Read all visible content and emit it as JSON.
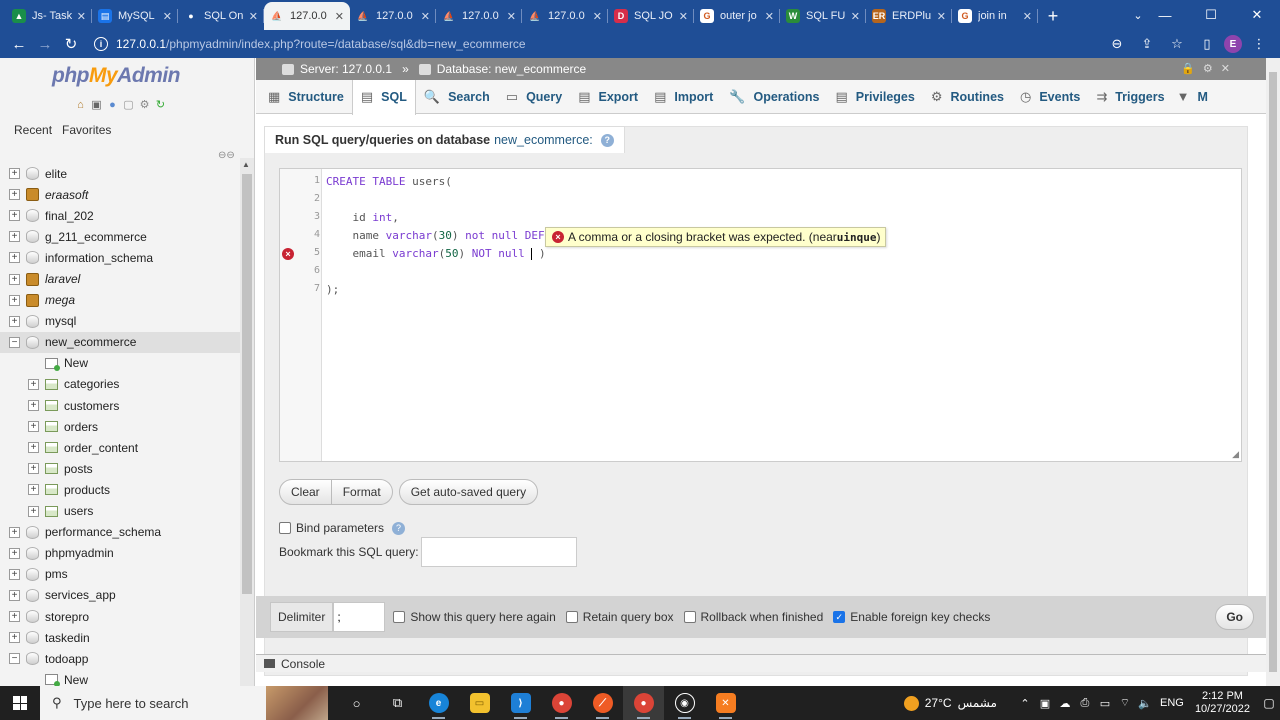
{
  "browser": {
    "tabs": [
      {
        "title": "Js- Task",
        "fav_color": "#1a8e4a",
        "fav_glyph": "▲"
      },
      {
        "title": "MySQL",
        "fav_color": "#1a73e8",
        "fav_glyph": "▤"
      },
      {
        "title": "SQL On",
        "fav_color": "#1f4e96",
        "fav_glyph": "●"
      },
      {
        "title": "127.0.0",
        "fav_color": "#f1f3f4",
        "fav_glyph": "⛵",
        "active": true
      },
      {
        "title": "127.0.0",
        "fav_color": "#1f4e96",
        "fav_glyph": "⛵"
      },
      {
        "title": "127.0.0",
        "fav_color": "#1f4e96",
        "fav_glyph": "⛵"
      },
      {
        "title": "127.0.0",
        "fav_color": "#1f4e96",
        "fav_glyph": "⛵"
      },
      {
        "title": "SQL JO",
        "fav_color": "#d62d4a",
        "fav_glyph": "D"
      },
      {
        "title": "outer jo",
        "fav_color": "#ffffff",
        "fav_glyph": "G"
      },
      {
        "title": "SQL FU",
        "fav_color": "#2a8c3a",
        "fav_glyph": "W"
      },
      {
        "title": "ERDPlu",
        "fav_color": "#b5651d",
        "fav_glyph": "ER"
      },
      {
        "title": "join in",
        "fav_color": "#ffffff",
        "fav_glyph": "G"
      }
    ],
    "url_host": "127.0.0.1",
    "url_path": "/phpmyadmin/index.php?route=/database/sql&db=new_ecommerce",
    "profile_initial": "E"
  },
  "nav": {
    "logo_php": "php",
    "logo_my": "My",
    "logo_admin": "Admin",
    "recent": "Recent",
    "favorites": "Favorites",
    "tree": [
      {
        "name": "elite",
        "type": "db",
        "level": 0
      },
      {
        "name": "eraasoft",
        "type": "group",
        "level": 0
      },
      {
        "name": "final_202",
        "type": "db",
        "level": 0
      },
      {
        "name": "g_211_ecommerce",
        "type": "db",
        "level": 0
      },
      {
        "name": "information_schema",
        "type": "db",
        "level": 0
      },
      {
        "name": "laravel",
        "type": "group",
        "level": 0
      },
      {
        "name": "mega",
        "type": "group",
        "level": 0
      },
      {
        "name": "mysql",
        "type": "db",
        "level": 0
      },
      {
        "name": "new_ecommerce",
        "type": "db",
        "level": 0,
        "expanded": true,
        "selected": true
      },
      {
        "name": "New",
        "type": "new",
        "level": 1
      },
      {
        "name": "categories",
        "type": "table",
        "level": 1
      },
      {
        "name": "customers",
        "type": "table",
        "level": 1
      },
      {
        "name": "orders",
        "type": "table",
        "level": 1
      },
      {
        "name": "order_content",
        "type": "table",
        "level": 1
      },
      {
        "name": "posts",
        "type": "table",
        "level": 1
      },
      {
        "name": "products",
        "type": "table",
        "level": 1
      },
      {
        "name": "users",
        "type": "table",
        "level": 1
      },
      {
        "name": "performance_schema",
        "type": "db",
        "level": 0
      },
      {
        "name": "phpmyadmin",
        "type": "db",
        "level": 0
      },
      {
        "name": "pms",
        "type": "db",
        "level": 0
      },
      {
        "name": "services_app",
        "type": "db",
        "level": 0
      },
      {
        "name": "storepro",
        "type": "db",
        "level": 0
      },
      {
        "name": "taskedin",
        "type": "db",
        "level": 0
      },
      {
        "name": "todoapp",
        "type": "db",
        "level": 0,
        "expanded": true
      },
      {
        "name": "New",
        "type": "new",
        "level": 1
      }
    ]
  },
  "main": {
    "server": "Server: 127.0.0.1",
    "database": "Database: new_ecommerce",
    "tabs": [
      {
        "label": "Structure",
        "icon": "▦"
      },
      {
        "label": "SQL",
        "icon": "▤",
        "active": true
      },
      {
        "label": "Search",
        "icon": "🔍"
      },
      {
        "label": "Query",
        "icon": "▭"
      },
      {
        "label": "Export",
        "icon": "▤"
      },
      {
        "label": "Import",
        "icon": "▤"
      },
      {
        "label": "Operations",
        "icon": "🔧"
      },
      {
        "label": "Privileges",
        "icon": "▤"
      },
      {
        "label": "Routines",
        "icon": "⚙"
      },
      {
        "label": "Events",
        "icon": "◷"
      },
      {
        "label": "Triggers",
        "icon": "⇉"
      }
    ],
    "more_label": "M",
    "run_heading": "Run SQL query/queries on database",
    "run_db": "new_ecommerce:",
    "line_numbers": [
      "1",
      "2",
      "3",
      "4",
      "5",
      "6",
      "7"
    ],
    "error_line": 5,
    "error_message": "A comma or a closing bracket was expected. (near ",
    "error_near": "uinque",
    "error_close": ")",
    "buttons": {
      "clear": "Clear",
      "format": "Format",
      "autosaved": "Get auto-saved query"
    },
    "bind_parameters": "Bind parameters",
    "bookmark_label": "Bookmark this SQL query:",
    "delimiter_label": "Delimiter",
    "delimiter_value": ";",
    "options": [
      {
        "label": "Show this query here again",
        "checked": false
      },
      {
        "label": "Retain query box",
        "checked": false
      },
      {
        "label": "Rollback when finished",
        "checked": false
      },
      {
        "label": "Enable foreign key checks",
        "checked": true
      }
    ],
    "go": "Go",
    "console": "Console"
  },
  "taskbar": {
    "search_placeholder": "Type here to search",
    "temperature": "27°C",
    "weather_text": "مشمس",
    "lang": "ENG",
    "time": "2:12 PM",
    "date": "10/27/2022"
  }
}
